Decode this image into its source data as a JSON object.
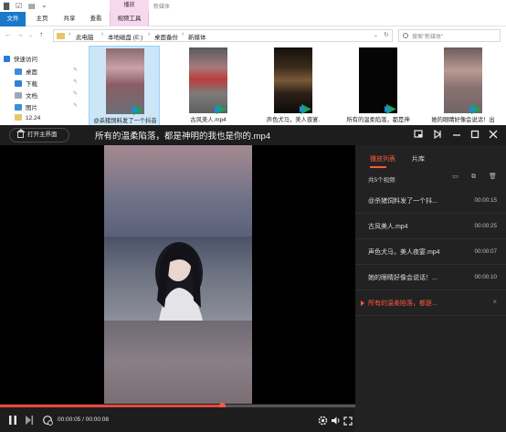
{
  "explorer": {
    "title_context": "播放",
    "window_title": "新媒体",
    "ribbon_tabs": [
      "文件",
      "主页",
      "共享",
      "查看",
      "视频工具"
    ],
    "breadcrumbs": [
      "此电脑",
      "本地磁盘 (E:)",
      "桌面备份",
      "新媒体"
    ],
    "search_placeholder": "搜索\"新媒体\"",
    "nav_items": [
      {
        "label": "快速访问",
        "icon": "star-icon",
        "color": "#2b7bd6"
      },
      {
        "label": "桌面",
        "icon": "desktop-icon",
        "color": "#3b8edb"
      },
      {
        "label": "下载",
        "icon": "download-icon",
        "color": "#2f7fd8"
      },
      {
        "label": "文档",
        "icon": "document-icon",
        "color": "#9aa7b5"
      },
      {
        "label": "图片",
        "icon": "picture-icon",
        "color": "#3b8edb"
      },
      {
        "label": "12.24",
        "icon": "folder-icon",
        "color": "#e9c46a"
      }
    ],
    "files": [
      {
        "caption": "@杀猪饲料发了一个抖音"
      },
      {
        "caption": "古风美人.mp4"
      },
      {
        "caption": "声色犬马，美人夜宴."
      },
      {
        "caption": "所有的温柔陷落，都是神"
      },
      {
        "caption": "她的眼睛好像会说话！出"
      }
    ]
  },
  "player": {
    "home_label": "打开主界面",
    "title": "所有的温柔陷落，都是神明的我也是你的.mp4",
    "progress_fraction": 0.625,
    "time_text": "00:00:05 / 00:00:08",
    "accent": "#ff5a3c",
    "playlist": {
      "tabs": [
        "播放列表",
        "片库"
      ],
      "count_text": "共5个视频",
      "items": [
        {
          "name": "@杀猪饲料发了一个抖...",
          "duration": "00:00:15"
        },
        {
          "name": "古风美人.mp4",
          "duration": "00:00:25"
        },
        {
          "name": "声色犬马，美人夜宴.mp4",
          "duration": "00:00:07"
        },
        {
          "name": "她的眼睛好像会说话！...",
          "duration": "00:00:10"
        },
        {
          "name": "所有的温柔陷落，都是...",
          "duration": ""
        }
      ]
    }
  }
}
